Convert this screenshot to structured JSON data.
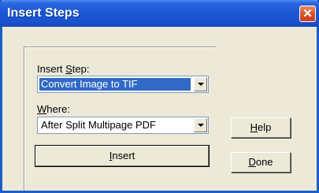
{
  "window": {
    "title": "Insert Steps",
    "close_glyph": "✕"
  },
  "insert_step": {
    "label_prefix": "Insert ",
    "label_accel": "S",
    "label_rest": "tep:",
    "value": "Convert Image to TIF"
  },
  "where": {
    "label_accel": "W",
    "label_rest": "here:",
    "value": "After Split Multipage PDF"
  },
  "buttons": {
    "insert_accel": "I",
    "insert_rest": "nsert",
    "help_accel": "H",
    "help_rest": "elp",
    "done_accel": "D",
    "done_rest": "one"
  },
  "colors": {
    "titlebar": "#1c56d5",
    "dialog_bg": "#ece9d8",
    "selection": "#316ac5",
    "close_button": "#d8552d"
  },
  "icons": {
    "close": "close-icon",
    "dropdown": "chevron-down-icon"
  }
}
